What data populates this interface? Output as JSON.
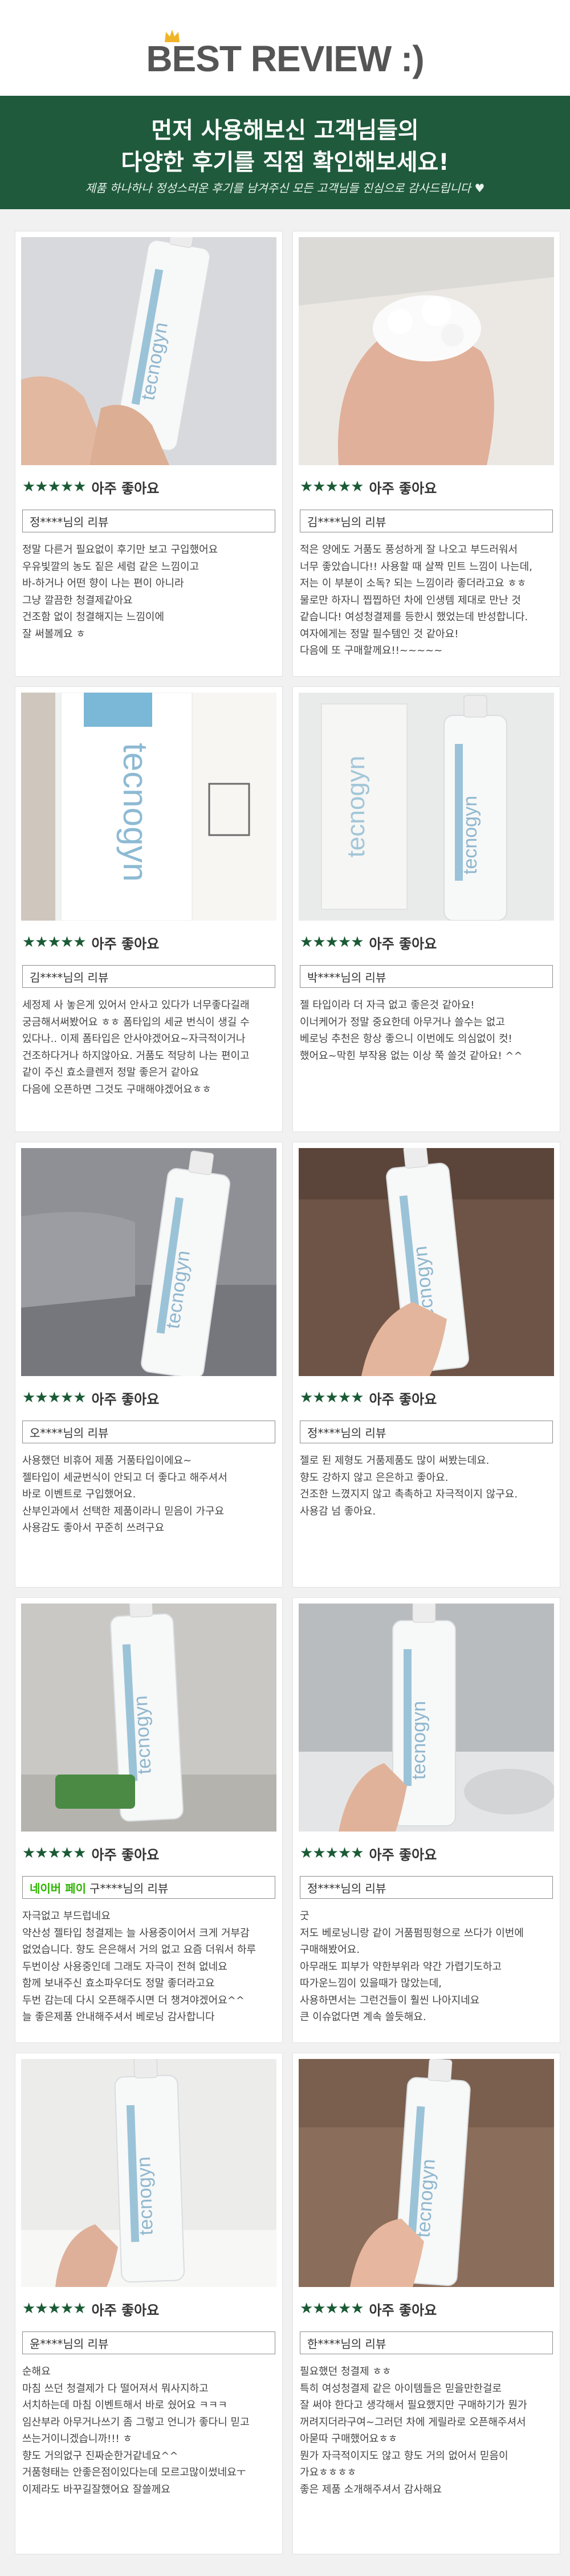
{
  "header": {
    "title": "BEST REVIEW :)",
    "banner_line1": "먼저 사용해보신 고객님들의",
    "banner_line2": "다양한 후기를 직접 확인해보세요!",
    "banner_sub": "제품 하나하나 정성스러운 후기를 남겨주신 모든 고객님들 진심으로 감사드립니다 ♥"
  },
  "reviews": [
    {
      "stars": "★★★★★",
      "rating_text": "아주 좋아요",
      "reviewer": "정****님의 리뷰",
      "photo": "hand-bottle-label",
      "body": [
        "정말 다른거 필요없이 후기만 보고 구입했어요",
        "우유빛깔의 농도 짙은 세럼 같은 느낌이고",
        "바-하거나 어떤 향이 나는 편이 아니라",
        "그냥 깔끔한 청결제같아요",
        "건조함 없이 청결해지는 느낌이에",
        "잘 써볼께요 ㅎ"
      ]
    },
    {
      "stars": "★★★★★",
      "rating_text": "아주 좋아요",
      "reviewer": "김****님의 리뷰",
      "photo": "hand-foam",
      "body": [
        "적은 양에도 거품도 풍성하게 잘 나오고 부드러워서",
        "너무 좋았습니다!! 사용할 때 살짝 민트 느낌이 나는데,",
        "저는 이 부분이 소독? 되는 느낌이라 좋더라고요 ㅎㅎ",
        "물로만 하자니 찝찝하던 차에 인생템 제대로 만난 것",
        "같습니다! 여성청결제를 등한시 했었는데 반성합니다.",
        "여자에게는 정말 필수템인 것 같아요!",
        "다음에 또 구매할께요!!~~~~~"
      ]
    },
    {
      "stars": "★★★★★",
      "rating_text": "아주 좋아요",
      "reviewer": "김****님의 리뷰",
      "photo": "bottle-closeup",
      "body": [
        "세정제 사 놓은게 있어서 안사고 있다가 너무좋다길래",
        "궁금해서써봤어요 ㅎㅎ 폼타입의 세균 번식이 생길 수",
        "있다나.. 이제 폼타입은 안사야겠어요~자극적이거나",
        "건조하다거나 하지않아요. 거품도 적당히 나는 편이고",
        "같이 주신 효소클렌저 정말 좋은거 같아요",
        "다음에 오픈하면 그것도 구매해야겠어요ㅎㅎ"
      ]
    },
    {
      "stars": "★★★★★",
      "rating_text": "아주 좋아요",
      "reviewer": "박****님의 리뷰",
      "photo": "box-and-bottle",
      "body": [
        "젤 타입이라 더 자극 없고 좋은것 같아요!",
        "이너케어가 정말 중요한데 아무거나 쓸수는 없고",
        "베로닝 추천은 항상 좋으니 이번에도 의심없이 컷!",
        "했어요~막힌 부작용 없는 이상 쭉 쓸것 같아요! ^^"
      ]
    },
    {
      "stars": "★★★★★",
      "rating_text": "아주 좋아요",
      "reviewer": "오****님의 리뷰",
      "photo": "bottle-on-sofa",
      "body": [
        "사용했던 비휴어 제품 거품타입이에요~",
        "젤타입이 세균번식이 안되고 더 좋다고 해주셔서",
        "바로 이벤트로 구입했어요.",
        "산부인과에서 선택한 제품이라니 믿음이 가구요",
        "사용감도 좋아서 꾸준히 쓰려구요"
      ]
    },
    {
      "stars": "★★★★★",
      "rating_text": "아주 좋아요",
      "reviewer": "정****님의 리뷰",
      "photo": "hand-holding-bottle",
      "body": [
        "젤로 된 제형도 거품제품도 많이 써봤는데요.",
        "향도 강하지 않고 은은하고 좋아요.",
        "건조한 느꼈지지 않고 촉촉하고 자극적이지 않구요.",
        "사용감 넘 좋아요."
      ]
    },
    {
      "stars": "★★★★★",
      "rating_text": "아주 좋아요",
      "reviewer": "구****님의 리뷰",
      "reviewer_tag": "네이버 페이",
      "photo": "bottle-tabletop",
      "body": [
        "자극없고 부드럽네요",
        "약산성 젤타입 청결제는 늘 사용중이어서 크게 거부감",
        "없었습니다. 향도 은은해서 거의 없고 요즘 더워서 하루",
        "두번이상 사용중인데 그래도 자극이 전혀 없네요",
        "함께 보내주신 효소파우더도 정말 좋더라고요",
        "두번 감는데 다시 오픈해주시면 더 챙겨야겠어요^^",
        "늘 좋은제품 안내해주셔서 베로닝 감사합니다"
      ]
    },
    {
      "stars": "★★★★★",
      "rating_text": "아주 좋아요",
      "reviewer": "정****님의 리뷰",
      "photo": "bottle-bathroom",
      "body": [
        "굿",
        "저도 베로닝니랑 같이 거품펌핑형으로 쓰다가 이번에",
        "구매해봤어요.",
        "아무래도 피부가 약한부위라 약간 가렵기도하고",
        "따가운느낌이 있을때가 많았는데,",
        "사용하면서는 그런건들이 훨씬 나아지네요",
        "큰 이슈없다면 계속 쓸듯해요."
      ]
    },
    {
      "stars": "★★★★★",
      "rating_text": "아주 좋아요",
      "reviewer": "윤****님의 리뷰",
      "photo": "bottle-white-table",
      "body": [
        "순해요",
        "마침 쓰던 청결제가 다 떨어져서 뭐사지하고",
        "서치하는데 마침 이벤트해서 바로 쉈어요 ㅋㅋㅋ",
        "임산부라 아무거나쓰기 좀 그렇고 언니가 좋다니 믿고",
        "쓰는거이니겠습니까!!! ㅎ",
        "향도 거의없구 진짜순한거같네요^^",
        "거품형태는 안좋은점이있다는데 모르고많이썼네요ㅜ",
        "이제라도 바꾸길잘했어요 잘쓸께요"
      ]
    },
    {
      "stars": "★★★★★",
      "rating_text": "아주 좋아요",
      "reviewer": "한****님의 리뷰",
      "photo": "bottle-in-hand-blue",
      "body": [
        "필요했던 청결제 ㅎㅎ",
        "특히 여성청결제 같은 아이템들은 믿을만한걸로",
        "잘 써야 한다고 생각해서 필요했지만 구매하기가 뭔가",
        "꺼려지더라구여~그러던 차에 게릴라로 오픈해주셔서",
        "아묻따 구매했어요ㅎㅎ",
        "뭔가 자극적이지도 않고 향도 거의 없어서 믿음이",
        "가요ㅎㅎㅎㅎ",
        "좋은 제품 소개해주셔서 감사해요"
      ]
    }
  ]
}
